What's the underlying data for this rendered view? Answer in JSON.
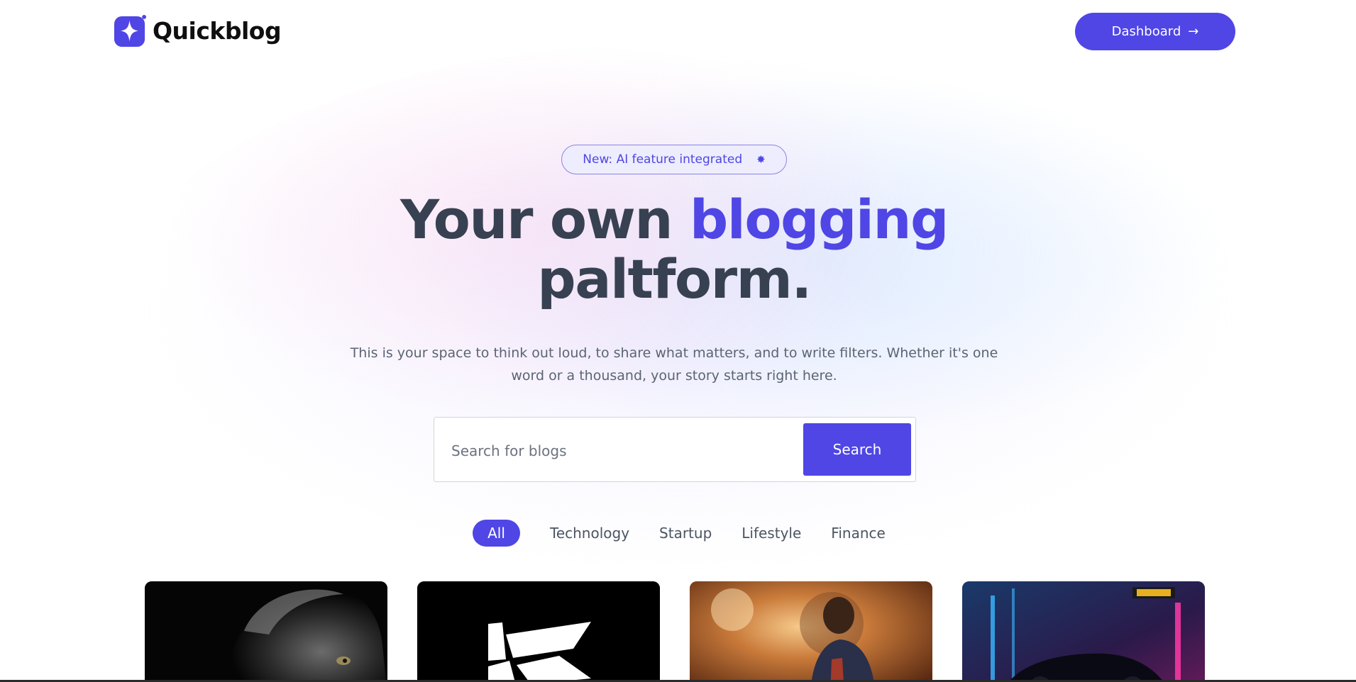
{
  "header": {
    "brand": "Quickblog",
    "dashboard_label": "Dashboard",
    "dashboard_icon": "arrow-right-icon"
  },
  "hero": {
    "badge_text": "New: AI feature integrated",
    "badge_icon": "sparkle-icon",
    "title_part1": "Your own ",
    "title_accent": "blogging",
    "title_part2": "paltform.",
    "description": "This is your space to think out loud, to share what matters, and to write filters. Whether it's one word or a thousand, your story starts right here."
  },
  "search": {
    "placeholder": "Search for blogs",
    "value": "",
    "button_label": "Search"
  },
  "categories": {
    "items": [
      "All",
      "Technology",
      "Startup",
      "Lifestyle",
      "Finance"
    ],
    "selected": "All"
  },
  "cards": [
    {
      "image": "goat-image"
    },
    {
      "image": "k-logo-image"
    },
    {
      "image": "footballer-fire-image"
    },
    {
      "image": "neon-car-image"
    }
  ],
  "colors": {
    "accent": "#4f46e5",
    "heading": "#374151",
    "body_text": "#5b6473",
    "badge_bg": "#eeedfd"
  }
}
